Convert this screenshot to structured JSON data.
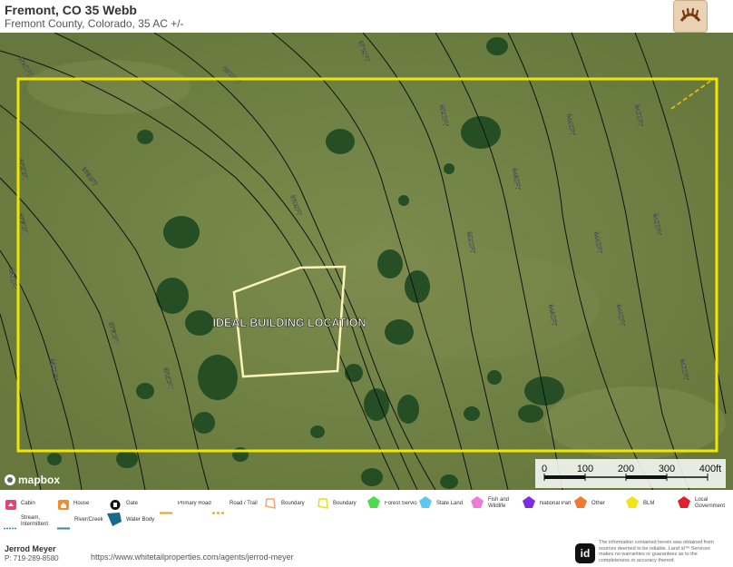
{
  "header": {
    "title": "Fremont, CO 35 Webb",
    "subtitle": "Fremont County, Colorado, 35 AC +/-"
  },
  "map": {
    "annotation": "IDEAL BUILDING LOCATION",
    "attribution": "mapbox",
    "contour_labels": [
      "8640FT",
      "8600FT",
      "8560FT",
      "8520FT",
      "8480FT",
      "8440FT",
      "8400FT",
      "8720FT",
      "8680FT",
      "8760FT",
      "8800FT"
    ],
    "scale_bar": {
      "ticks": [
        "0",
        "100",
        "200",
        "300",
        "400ft"
      ]
    },
    "colors": {
      "boundary": "#f2e600",
      "contour": "#000000",
      "background": "#6d7f42"
    }
  },
  "legend": {
    "items": [
      {
        "label": "Cabin",
        "icon": "cabin-icon",
        "color": "#e0457b"
      },
      {
        "label": "House",
        "icon": "house-icon",
        "color": "#f28a2e"
      },
      {
        "label": "Gate",
        "icon": "gate-icon",
        "color": "#111111"
      },
      {
        "label": "Primary Road",
        "icon": "primary-road-line",
        "color": "#e8a21a"
      },
      {
        "label": "Road / Trail",
        "icon": "road-trail-dashed-line",
        "color": "#e8a21a"
      },
      {
        "label": "Boundary",
        "icon": "boundary-orange-icon",
        "color": "#f0a868"
      },
      {
        "label": "Boundary",
        "icon": "boundary-yellow-icon",
        "color": "#e6e020"
      },
      {
        "label": "Forest Service",
        "icon": "forest-service-icon",
        "color": "#4ddb4d"
      },
      {
        "label": "State Land",
        "icon": "state-land-icon",
        "color": "#5ec9f0"
      },
      {
        "label": "Fish and Wildlife",
        "icon": "fish-wildlife-icon",
        "color": "#f07ad8"
      },
      {
        "label": "National Park",
        "icon": "national-park-icon",
        "color": "#7a2ee0"
      },
      {
        "label": "Other",
        "icon": "other-icon",
        "color": "#f07a30"
      },
      {
        "label": "BLM",
        "icon": "blm-icon",
        "color": "#f2e31a"
      },
      {
        "label": "Local Government",
        "icon": "local-government-icon",
        "color": "#e0202a"
      },
      {
        "label": "Stream, Intermittent",
        "icon": "stream-intermittent-line",
        "color": "#3a8a9a"
      },
      {
        "label": "River/Creek",
        "icon": "river-creek-line",
        "color": "#3a8a9a"
      },
      {
        "label": "Water Body",
        "icon": "water-body-icon",
        "color": "#1a6a8a"
      }
    ]
  },
  "footer": {
    "agent_name": "Jerrod Meyer",
    "phone": "P: 719-289-8580",
    "url": "https://www.whitetailproperties.com/agents/jerrod-meyer",
    "id_logo": "id",
    "disclaimer": "The information contained herein was obtained from sources deemed to be reliable. Land id™ Services makes no warranties or guarantees as to the completeness or accuracy thereof."
  }
}
